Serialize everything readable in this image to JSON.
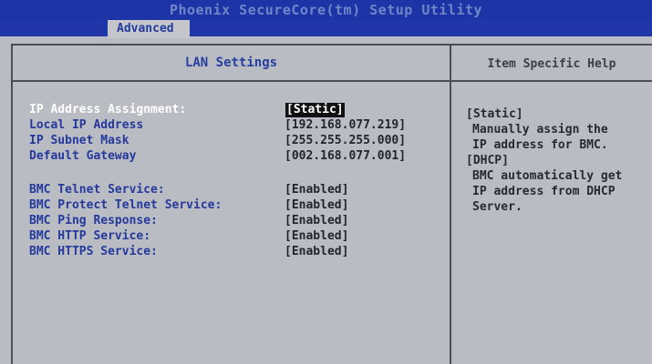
{
  "titlebar": {
    "title": "Phoenix SecureCore(tm) Setup Utility"
  },
  "tabs": [
    {
      "label": "Advanced"
    }
  ],
  "main": {
    "header": "LAN Settings",
    "fields": [
      {
        "label": "IP Address Assignment:",
        "value": "[Static]"
      },
      {
        "label": "Local IP Address",
        "value": "[192.168.077.219]"
      },
      {
        "label": "IP Subnet Mask",
        "value": "[255.255.255.000]"
      },
      {
        "label": "Default Gateway",
        "value": "[002.168.077.001]"
      },
      {
        "label": "BMC Telnet Service:",
        "value": "[Enabled]"
      },
      {
        "label": "BMC Protect Telnet Service:",
        "value": "[Enabled]"
      },
      {
        "label": "BMC Ping Response:",
        "value": "[Enabled]"
      },
      {
        "label": "BMC HTTP Service:",
        "value": "[Enabled]"
      },
      {
        "label": "BMC HTTPS Service:",
        "value": "[Enabled]"
      }
    ]
  },
  "help": {
    "header": "Item Specific Help",
    "lines": [
      "[Static]",
      "Manually assign the",
      "IP address for BMC.",
      "[DHCP]",
      "BMC automatically get",
      "IP address from DHCP",
      "Server."
    ]
  },
  "colors": {
    "title_bar": "#1d34a6",
    "screen_bg": "#b9bcc2",
    "label_text": "#24399b",
    "highlight": "#ffffff"
  }
}
